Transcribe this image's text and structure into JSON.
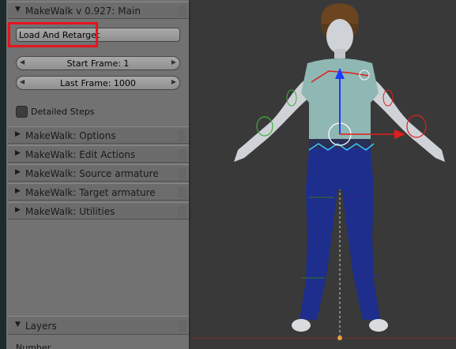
{
  "panel": {
    "main_header": "MakeWalk v 0.927: Main",
    "load_retarget_label": "Load And Retarget",
    "start_frame_label": "Start Frame: 1",
    "last_frame_label": "Last Frame: 1000",
    "detailed_steps_label": "Detailed Steps",
    "sections": [
      {
        "label": "MakeWalk: Options"
      },
      {
        "label": "MakeWalk: Edit Actions"
      },
      {
        "label": "MakeWalk: Source armature"
      },
      {
        "label": "MakeWalk: Target armature"
      },
      {
        "label": "MakeWalk: Utilities"
      }
    ],
    "layers_header": "Layers",
    "number_label": "Number"
  },
  "colors": {
    "highlight": "#e8141e",
    "shirt": "#8fb7b3",
    "pants": "#1e2e8c",
    "axis_x": "#e11d1d",
    "axis_z": "#1a3cff"
  }
}
